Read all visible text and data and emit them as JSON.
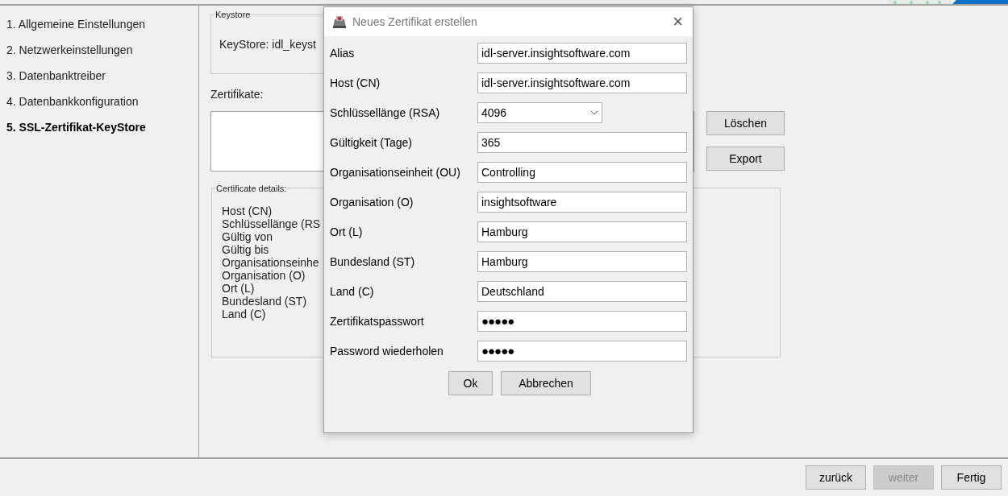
{
  "sidebar": {
    "items": [
      {
        "label": "1. Allgemeine Einstellungen",
        "selected": false
      },
      {
        "label": "2. Netzwerkeinstellungen",
        "selected": false
      },
      {
        "label": "3. Datenbanktreiber",
        "selected": false
      },
      {
        "label": "4. Datenbankkonfiguration",
        "selected": false
      },
      {
        "label": "5. SSL-Zertifikat-KeyStore",
        "selected": true
      }
    ]
  },
  "keystore": {
    "title": "Keystore",
    "text": "KeyStore: idl_keyst"
  },
  "certificates": {
    "label": "Zertifikate:",
    "buttons": [
      "Löschen",
      "Export"
    ]
  },
  "details": {
    "title": "Certificate details:",
    "rows": [
      "Host (CN)",
      "Schlüssellänge (RS",
      "Gültig von",
      "Gültig bis",
      "Organisationseinhe",
      "Organisation (O)",
      "Ort (L)",
      "Bundesland (ST)",
      "Land (C)"
    ]
  },
  "dialog": {
    "title": "Neues Zertifikat erstellen",
    "close": "×",
    "fields": [
      {
        "label": "Alias",
        "kind": "text",
        "value": "idl-server.insightsoftware.com"
      },
      {
        "label": "Host (CN)",
        "kind": "text",
        "value": "idl-server.insightsoftware.com"
      },
      {
        "label": "Schlüssellänge (RSA)",
        "kind": "select",
        "value": "4096"
      },
      {
        "label": "Gültigkeit (Tage)",
        "kind": "text",
        "value": "365"
      },
      {
        "label": "Organisationseinheit (OU)",
        "kind": "text",
        "value": "Controlling"
      },
      {
        "label": "Organisation (O)",
        "kind": "text",
        "value": "insightsoftware"
      },
      {
        "label": "Ort (L)",
        "kind": "text",
        "value": "Hamburg"
      },
      {
        "label": "Bundesland (ST)",
        "kind": "text",
        "value": "Hamburg"
      },
      {
        "label": "Land (C)",
        "kind": "text",
        "value": "Deutschland"
      },
      {
        "label": "Zertifikatspasswort",
        "kind": "password",
        "value": "●●●●●"
      },
      {
        "label": "Password wiederholen",
        "kind": "password",
        "value": "●●●●●"
      }
    ],
    "buttons": [
      "Ok",
      "Abbrechen"
    ]
  },
  "footer": {
    "buttons": [
      {
        "label": "zurück",
        "disabled": false
      },
      {
        "label": "weiter",
        "disabled": true
      },
      {
        "label": "Fertig",
        "disabled": false
      }
    ]
  }
}
